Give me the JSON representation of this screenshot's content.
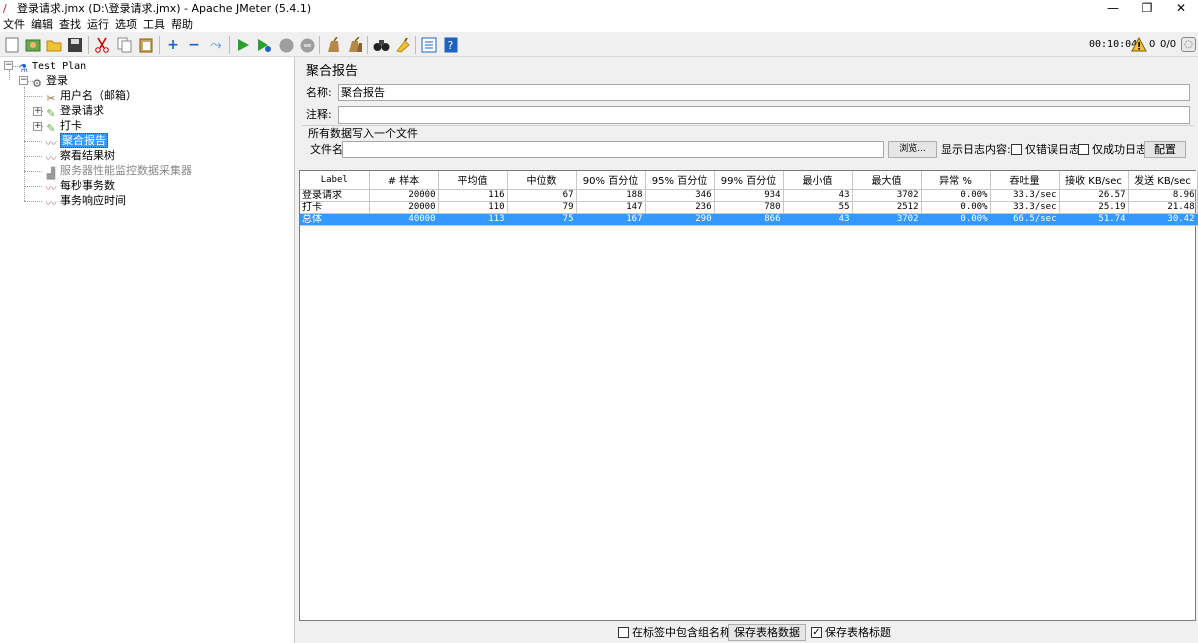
{
  "window": {
    "title": "登录请求.jmx (D:\\登录请求.jmx) - Apache JMeter (5.4.1)",
    "minimize": "—",
    "restore": "❐",
    "close": "✕"
  },
  "menu": [
    "文件",
    "编辑",
    "查找",
    "运行",
    "选项",
    "工具",
    "帮助"
  ],
  "toolbar": {
    "timer": "00:10:04",
    "error_count": "0",
    "threads": "0/0"
  },
  "tree": {
    "root": "Test Plan",
    "group": "登录",
    "items": [
      {
        "label": "用户名（邮箱）"
      },
      {
        "label": "登录请求"
      },
      {
        "label": "打卡"
      },
      {
        "label": "聚合报告"
      },
      {
        "label": "察看结果树"
      },
      {
        "label": "服务器性能监控数据采集器"
      },
      {
        "label": "每秒事务数"
      },
      {
        "label": "事务响应时间"
      }
    ]
  },
  "panel": {
    "title": "聚合报告",
    "name_label": "名称:",
    "name_value": "聚合报告",
    "comment_label": "注释:",
    "comment_value": "",
    "file_group_title": "所有数据写入一个文件",
    "filename_label": "文件名",
    "filename_value": "",
    "browse_label": "浏览...",
    "log_label": "显示日志内容:",
    "errors_only_label": "仅错误日志",
    "success_only_label": "仅成功日志",
    "configure_label": "配置"
  },
  "table": {
    "columns": [
      "Label",
      "# 样本",
      "平均值",
      "中位数",
      "90% 百分位",
      "95% 百分位",
      "99% 百分位",
      "最小值",
      "最大值",
      "异常 %",
      "吞吐量",
      "接收 KB/sec",
      "发送 KB/sec"
    ],
    "rows": [
      [
        "登录请求",
        "20000",
        "116",
        "67",
        "188",
        "346",
        "934",
        "43",
        "3702",
        "0.00%",
        "33.3/sec",
        "26.57",
        "8.96"
      ],
      [
        "打卡",
        "20000",
        "110",
        "79",
        "147",
        "236",
        "780",
        "55",
        "2512",
        "0.00%",
        "33.3/sec",
        "25.19",
        "21.48"
      ],
      [
        "总体",
        "40000",
        "113",
        "75",
        "167",
        "290",
        "866",
        "43",
        "3702",
        "0.00%",
        "66.5/sec",
        "51.74",
        "30.42"
      ]
    ]
  },
  "bottom": {
    "include_group_label": "在标签中包含组名称?",
    "include_group_checked": false,
    "save_table_label": "保存表格数据",
    "save_header_label": "保存表格标题",
    "save_header_checked": true
  }
}
